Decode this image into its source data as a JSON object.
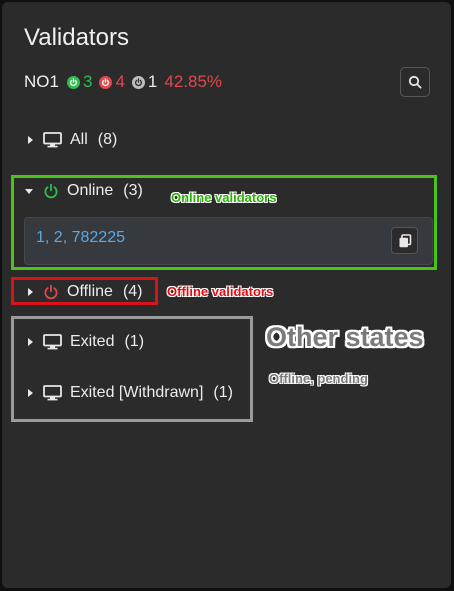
{
  "header": {
    "title": "Validators"
  },
  "summary": {
    "network": "NO1",
    "online_count": "3",
    "offline_count": "4",
    "other_count": "1",
    "percent": "42.85%"
  },
  "colors": {
    "online": "#2ebd4e",
    "offline": "#e0484c",
    "other": "#bdbdbd",
    "link": "#5aa9e6"
  },
  "groups": {
    "all": {
      "label": "All",
      "count": "(8)"
    },
    "online": {
      "label": "Online",
      "count": "(3)",
      "ids": [
        "1",
        "2",
        "782225"
      ]
    },
    "offline": {
      "label": "Offline",
      "count": "(4)"
    },
    "exited": {
      "label": "Exited",
      "count": "(1)"
    },
    "exited_withdrawn": {
      "label": "Exited [Withdrawn]",
      "count": "(1)"
    }
  },
  "annotations": {
    "online": "Online validators",
    "offline": "Offline validators",
    "other_title": "Other states",
    "other_sub": "Offline, pending"
  },
  "icons": {
    "search": "search-icon",
    "copy": "copy-icon",
    "power": "power-icon",
    "monitor": "monitor-icon"
  }
}
